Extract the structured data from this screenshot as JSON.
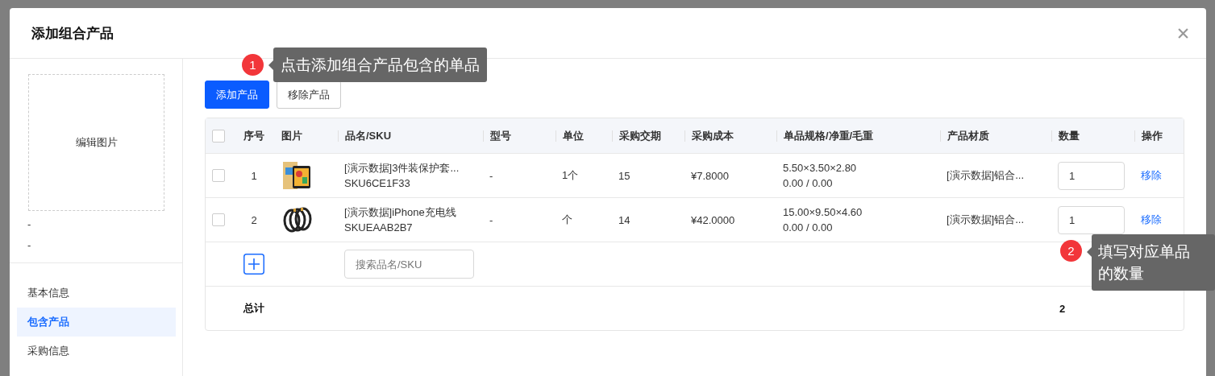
{
  "dialog": {
    "title": "添加组合产品"
  },
  "sidebar": {
    "image_label": "编辑图片",
    "fields": [
      "-",
      "-"
    ],
    "nav": [
      {
        "label": "基本信息",
        "selected": false
      },
      {
        "label": "包含产品",
        "selected": true
      },
      {
        "label": "采购信息",
        "selected": false
      }
    ]
  },
  "toolbar": [
    {
      "label": "添加产品",
      "kind": "primary"
    },
    {
      "label": "移除产品",
      "kind": "default"
    }
  ],
  "table": {
    "header_checked": false,
    "columns": [
      "序号",
      "图片",
      "品名/SKU",
      "型号",
      "单位",
      "采购交期",
      "采购成本",
      "单品规格/净重/毛重",
      "产品材质",
      "数量",
      "操作"
    ],
    "rows": [
      {
        "checked": false,
        "index": "1",
        "name": "[演示数据]3件装保护套...",
        "sku": "SKU6CE1F33",
        "model": "-",
        "unit": "1个",
        "lead_time": "15",
        "cost": "¥7.8000",
        "spec": "5.50×3.50×2.80",
        "weight": "0.00 / 0.00",
        "material": "[演示数据]铝合...",
        "quantity": "1",
        "action": "移除"
      },
      {
        "checked": false,
        "index": "2",
        "name": "[演示数据]iPhone充电线",
        "sku": "SKUEAAB2B7",
        "model": "-",
        "unit": "个",
        "lead_time": "14",
        "cost": "¥42.0000",
        "spec": "15.00×9.50×4.60",
        "weight": "0.00 / 0.00",
        "material": "[演示数据]铝合...",
        "quantity": "1",
        "action": "移除"
      }
    ],
    "search": {
      "placeholder": "搜索品名/SKU"
    },
    "total": {
      "label": "总计",
      "quantity": "2"
    }
  },
  "callouts": [
    {
      "number": "1",
      "text": "点击添加组合产品包含的单品"
    },
    {
      "number": "2",
      "text": "填写对应单品的数量"
    }
  ]
}
